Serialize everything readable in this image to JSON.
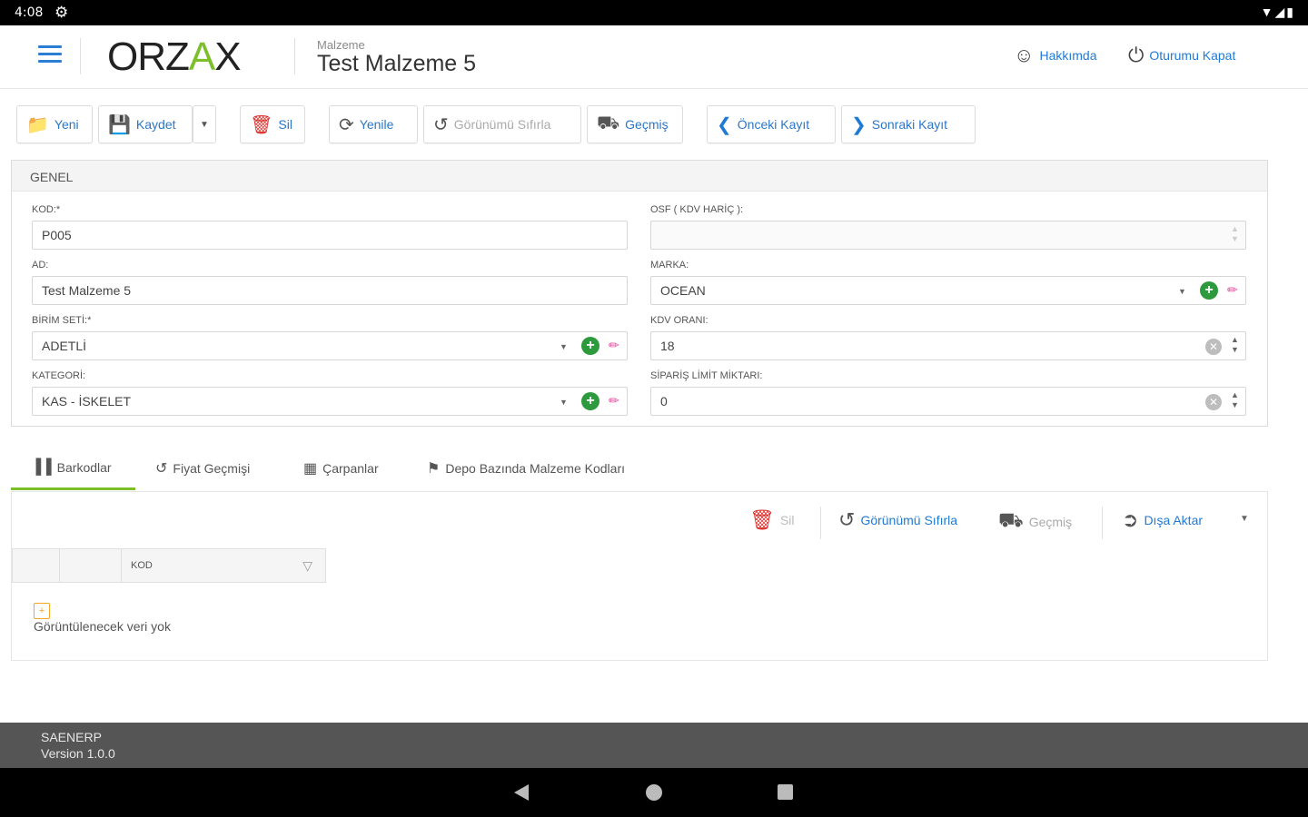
{
  "status_bar": {
    "time": "4:08",
    "gear": "⚙",
    "system_icons": "▼◢▮"
  },
  "header": {
    "logo": {
      "pre": "ORZ",
      "mark": "A",
      "post": "X"
    },
    "subtitle": "Malzeme",
    "title": "Test Malzeme 5",
    "about_label": "Hakkımda",
    "logout_label": "Oturumu Kapat"
  },
  "toolbar": {
    "new_label": "Yeni",
    "save_label": "Kaydet",
    "delete_label": "Sil",
    "refresh_label": "Yenile",
    "reset_view_label": "Görünümü Sıfırla",
    "history_label": "Geçmiş",
    "prev_label": "Önceki Kayıt",
    "next_label": "Sonraki Kayıt"
  },
  "general": {
    "section_title": "GENEL",
    "fields": {
      "kod": {
        "label": "KOD:*",
        "value": "P005"
      },
      "ad": {
        "label": "AD:",
        "value": "Test Malzeme 5"
      },
      "birim_seti": {
        "label": "BİRİM SETİ:*",
        "value": "ADETLİ"
      },
      "kategori": {
        "label": "KATEGORİ:",
        "value": "KAS - İSKELET"
      },
      "osf": {
        "label": "OSF ( KDV HARİÇ ):",
        "value": ""
      },
      "marka": {
        "label": "MARKA:",
        "value": "OCEAN"
      },
      "kdv_orani": {
        "label": "KDV ORANI:",
        "value": "18"
      },
      "siparis_limit": {
        "label": "SİPARİŞ LİMİT MİKTARI:",
        "value": "0"
      }
    }
  },
  "tabs": [
    {
      "label": "Barkodlar",
      "icon": "barcode-icon"
    },
    {
      "label": "Fiyat Geçmişi",
      "icon": "history-icon"
    },
    {
      "label": "Çarpanlar",
      "icon": "calculator-icon"
    },
    {
      "label": "Depo Bazında Malzeme Kodları",
      "icon": "tags-icon"
    }
  ],
  "grid": {
    "delete_label": "Sil",
    "reset_view_label": "Görünümü Sıfırla",
    "history_label": "Geçmiş",
    "export_label": "Dışa Aktar",
    "column_kod": "KOD",
    "no_data": "Görüntülenecek veri yok"
  },
  "footer": {
    "app_name": "SAENERP",
    "version": "Version 1.0.0"
  },
  "colors": {
    "accent": "#1f7ad6",
    "brand_green": "#7cbf2a",
    "danger": "#d9302b",
    "footer_bg": "#555555"
  }
}
